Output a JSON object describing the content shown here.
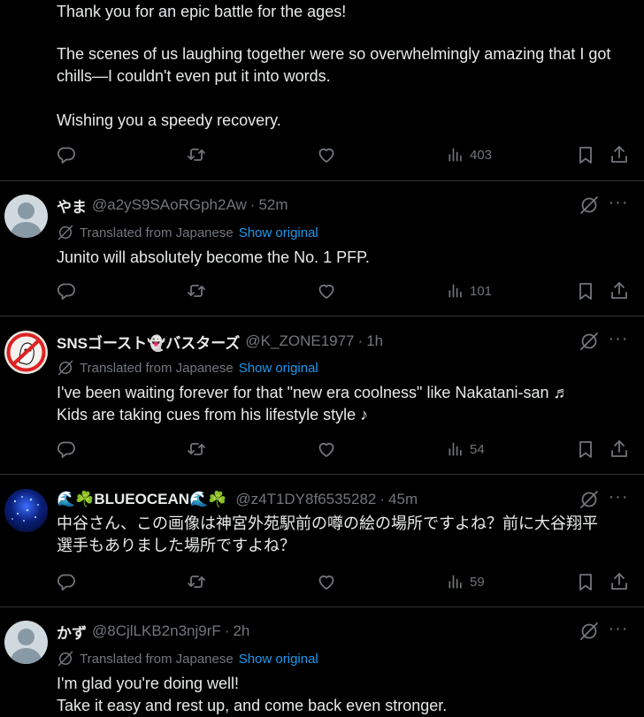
{
  "top_post": {
    "lines": [
      "Thank you for an epic battle for the ages!",
      "The scenes of us laughing together were so overwhelmingly amazing that I got chills—I couldn't even put it into words.",
      "Wishing you a speedy recovery."
    ],
    "views": "403"
  },
  "translated_label": "Translated from Japanese",
  "show_original_label": "Show original",
  "more_glyph": "···",
  "replies": [
    {
      "name": "やま",
      "handle": "@a2yS9SAoRGph2Aw",
      "time": "52m",
      "text": "Junito will absolutely become the No. 1 PFP.",
      "views": "101"
    },
    {
      "name": "SNSゴースト👻バスターズ",
      "handle": "@K_ZONE1977",
      "time": "1h",
      "text": "I've been waiting forever for that \"new era coolness\" like Nakatani-san ♬\nKids are taking cues from his lifestyle style ♪",
      "views": "54"
    },
    {
      "name": "🌊☘️BLUEOCEAN🌊☘️",
      "handle": "@z4T1DY8f6535282",
      "time": "45m",
      "text": "中谷さん、この画像は神宮外苑駅前の噂の絵の場所ですよね？前に大谷翔平\n選手もありました場所ですよね？",
      "views": "59"
    },
    {
      "name": "かず",
      "handle": "@8CjlLKB2n3nj9rF",
      "time": "2h",
      "text": "I'm glad you're doing well!\nTake it easy and rest up, and come back even stronger."
    }
  ],
  "icons": {
    "reply": "reply-icon",
    "repost": "repost-icon",
    "like": "like-icon",
    "views": "views-icon",
    "bookmark": "bookmark-icon",
    "share": "share-icon",
    "grok": "grok-icon",
    "translate": "translate-icon",
    "more": "more-icon"
  },
  "colors": {
    "background": "#000000",
    "text": "#e7e9ea",
    "muted": "#71767b",
    "link": "#1d9bf0",
    "divider": "#2f3336"
  }
}
